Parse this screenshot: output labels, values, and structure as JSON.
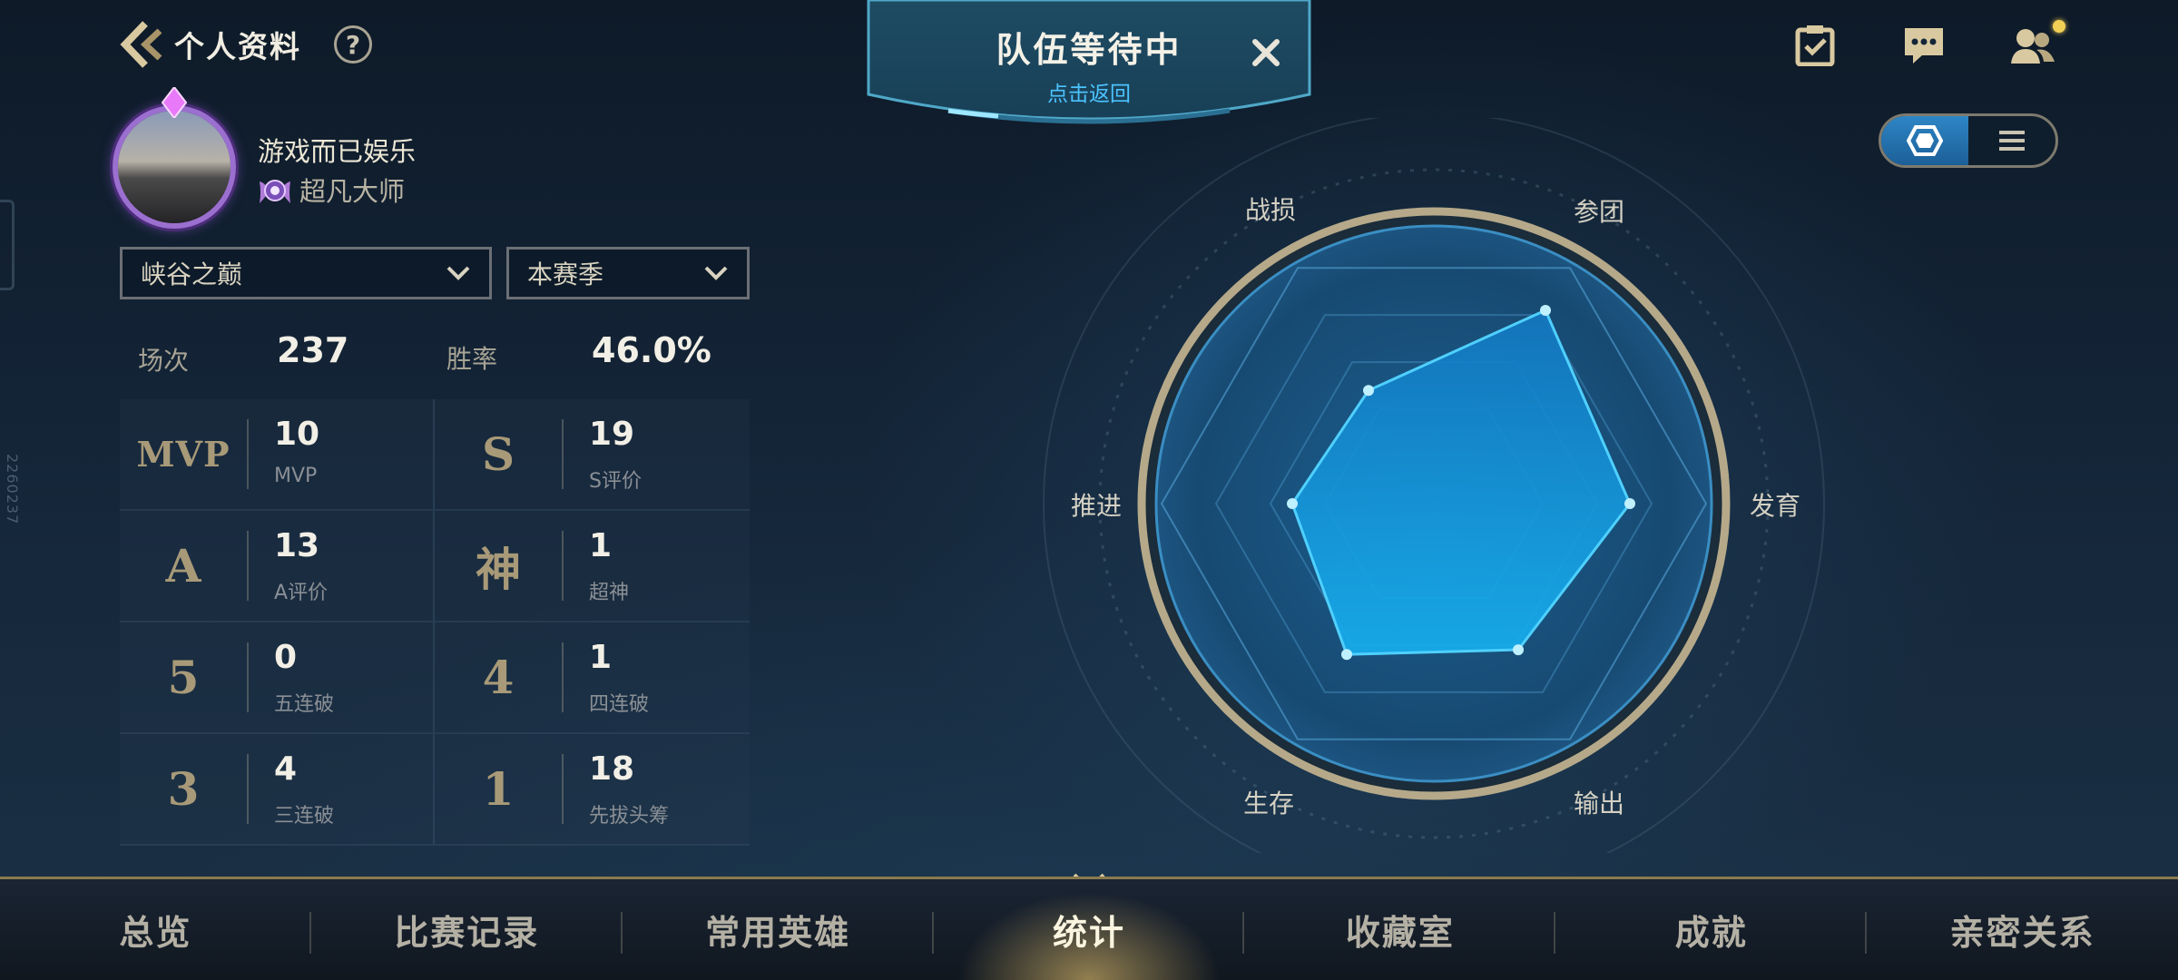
{
  "header": {
    "title": "个人资料",
    "help": "?"
  },
  "queue": {
    "title": "队伍等待中",
    "subtitle": "点击返回"
  },
  "top_icons": [
    "task-icon",
    "chat-icon",
    "friends-icon"
  ],
  "view_toggle": {
    "active": "radar",
    "options": [
      "radar-view-icon",
      "list-view-icon"
    ]
  },
  "profile": {
    "username": "游戏而已娱乐",
    "rank": "超凡大师"
  },
  "filters": {
    "mode": "峡谷之巅",
    "season": "本赛季"
  },
  "summary": {
    "games_label": "场次",
    "games": "237",
    "winrate_label": "胜率",
    "winrate": "46.0%"
  },
  "stats": [
    {
      "icon": "MVP",
      "value": "10",
      "label": "MVP"
    },
    {
      "icon": "S",
      "value": "19",
      "label": "S评价"
    },
    {
      "icon": "A",
      "value": "13",
      "label": "A评价"
    },
    {
      "icon": "神",
      "value": "1",
      "label": "超神"
    },
    {
      "icon": "5",
      "value": "0",
      "label": "五连破"
    },
    {
      "icon": "4",
      "value": "1",
      "label": "四连破"
    },
    {
      "icon": "3",
      "value": "4",
      "label": "三连破"
    },
    {
      "icon": "1",
      "value": "18",
      "label": "先拔头筹"
    }
  ],
  "radar": {
    "axes": [
      "战损",
      "参团",
      "发育",
      "输出",
      "生存",
      "推进"
    ],
    "values": [
      0.48,
      0.82,
      0.72,
      0.62,
      0.64,
      0.52
    ],
    "fill_color": "#1e9fe6",
    "stroke_color": "#4fd0ff"
  },
  "side_text": "2260237",
  "nav": {
    "items": [
      "总览",
      "比赛记录",
      "常用英雄",
      "统计",
      "收藏室",
      "成就",
      "亲密关系"
    ],
    "active_index": 3
  }
}
